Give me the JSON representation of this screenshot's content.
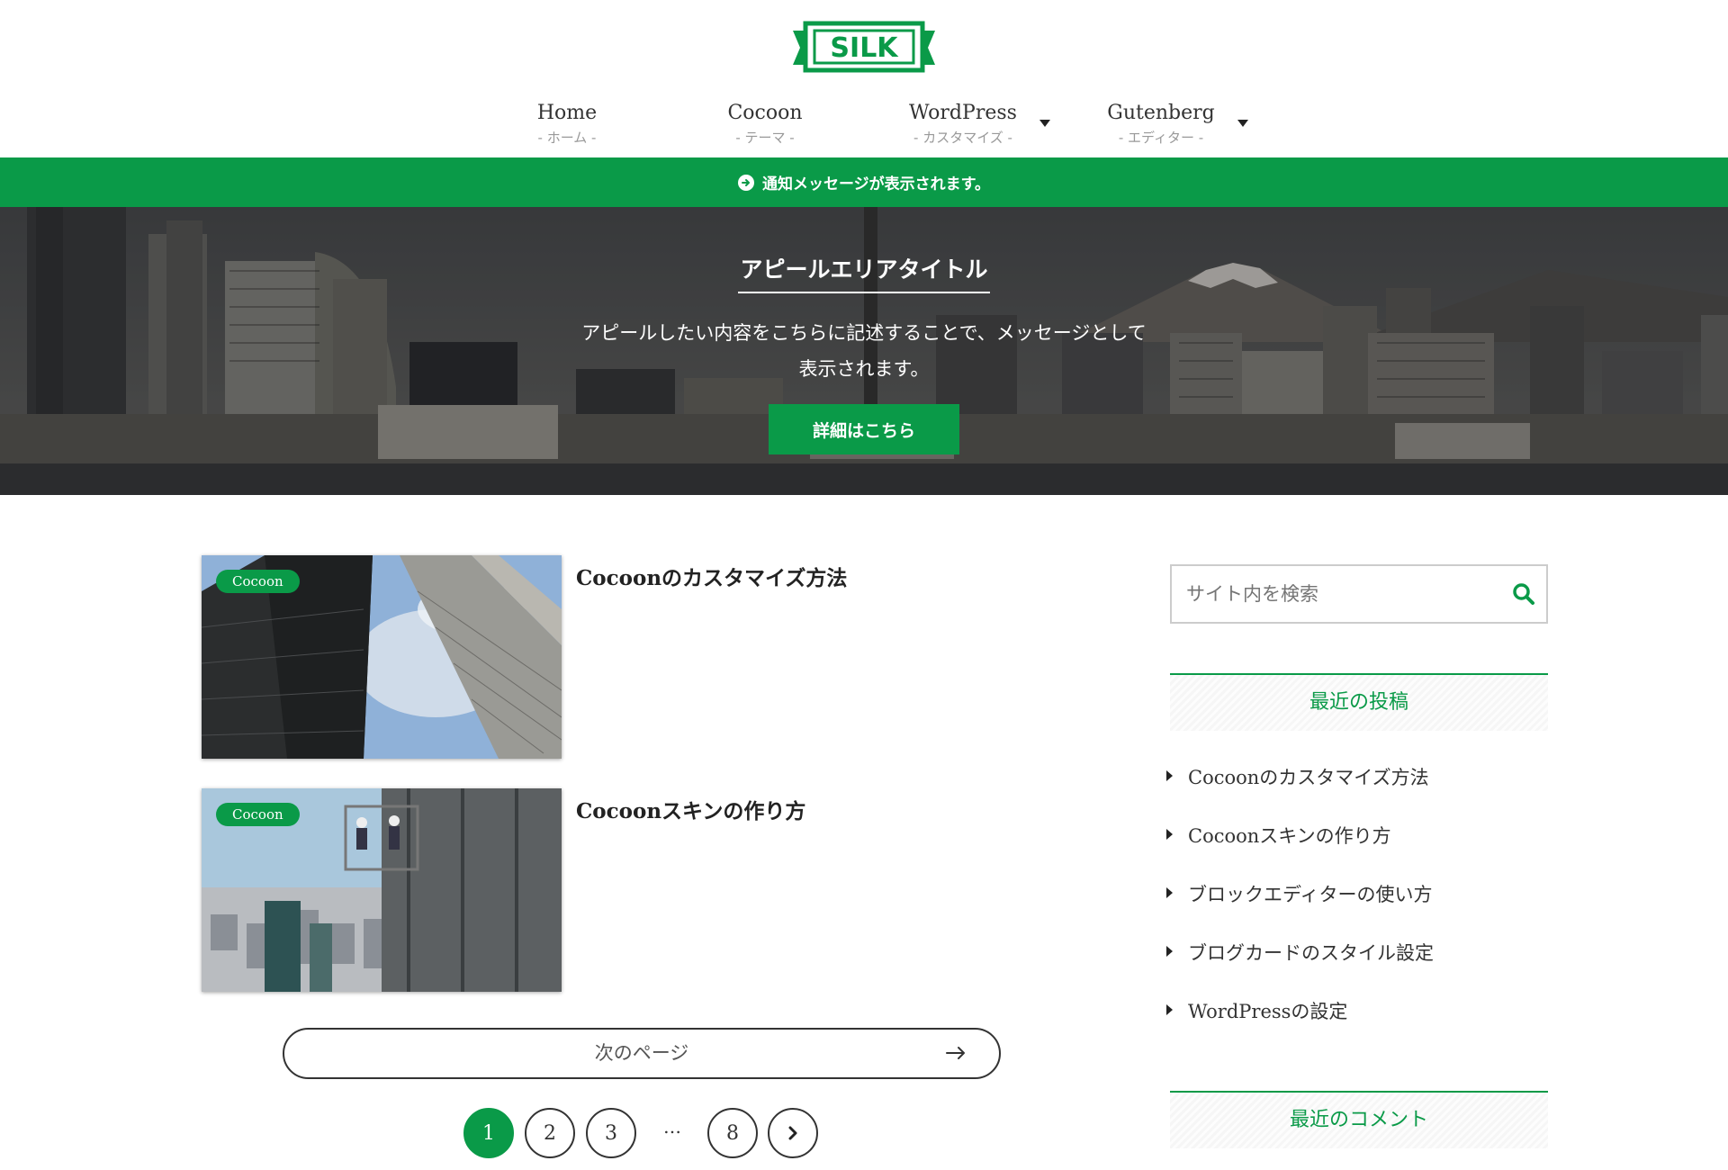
{
  "site": {
    "logo_text": "SILK",
    "brand_color": "#0a9a48"
  },
  "nav": {
    "items": [
      {
        "label": "Home",
        "sub": "- ホーム -"
      },
      {
        "label": "Cocoon",
        "sub": "- テーマ -"
      },
      {
        "label": "WordPress",
        "sub": "- カスタマイズ -"
      },
      {
        "label": "Gutenberg",
        "sub": "- エディター -"
      }
    ]
  },
  "notice": {
    "text": "通知メッセージが表示されます。",
    "icon": "arrow-circle-right-icon"
  },
  "appeal": {
    "title": "アピールエリアタイトル",
    "text": "アピールしたい内容をこちらに記述することで、メッセージとして表示されます。",
    "button": "詳細はこちら"
  },
  "posts": [
    {
      "category": "Cocoon",
      "title": "Cocoonのカスタマイズ方法"
    },
    {
      "category": "Cocoon",
      "title": "Cocoonスキンの作り方"
    }
  ],
  "pagination": {
    "next_label": "次のページ",
    "pages": [
      "1",
      "2",
      "3",
      "8"
    ],
    "current": "1",
    "ellipsis": "…"
  },
  "sidebar": {
    "search_placeholder": "サイト内を検索",
    "recent_posts_heading": "最近の投稿",
    "recent_posts": [
      "Cocoonのカスタマイズ方法",
      "Cocoonスキンの作り方",
      "ブロックエディターの使い方",
      "ブログカードのスタイル設定",
      "WordPressの設定"
    ],
    "recent_comments_heading": "最近のコメント"
  }
}
